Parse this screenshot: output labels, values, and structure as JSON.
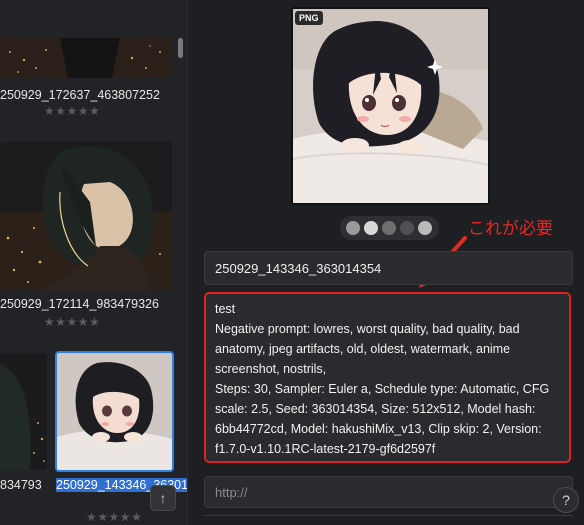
{
  "gallery": {
    "items": [
      {
        "filename": "250929_172637_463807252",
        "rating": "★★★★★"
      },
      {
        "filename": "250929_172114_983479326",
        "rating": "★★★★★"
      },
      {
        "filename": "834793",
        "rating": ""
      },
      {
        "filename": "250929_143346_363014354",
        "rating": "★★★★★",
        "selected": true
      }
    ],
    "scroll_up_icon": "↑"
  },
  "detail": {
    "format_badge": "PNG",
    "carousel_dots": [
      "#9a9a9a",
      "#d8d8d8",
      "#6f6f6f",
      "#4f5055",
      "#b9b9b9"
    ],
    "name_value": "250929_143346_363014354",
    "prompt_lines": [
      "test",
      "Negative prompt: lowres, worst quality, bad quality, bad anatomy, jpeg artifacts, old, oldest, watermark, anime screenshot, nostrils,",
      "Steps: 30, Sampler: Euler a, Schedule type: Automatic, CFG scale: 2.5, Seed: 363014354, Size: 512x512, Model hash: 6bb44772cd, Model: hakushiMix_v13, Clip skip: 2, Version: f1.7.0-v1.10.1RC-latest-2179-gf6d2597f"
    ],
    "url_placeholder": "http://",
    "help_label": "?"
  },
  "annotation": {
    "text": "これが必要",
    "color": "#e02a25"
  },
  "colors": {
    "highlight_border": "#e0201c",
    "selection": "#2f7fe0"
  }
}
